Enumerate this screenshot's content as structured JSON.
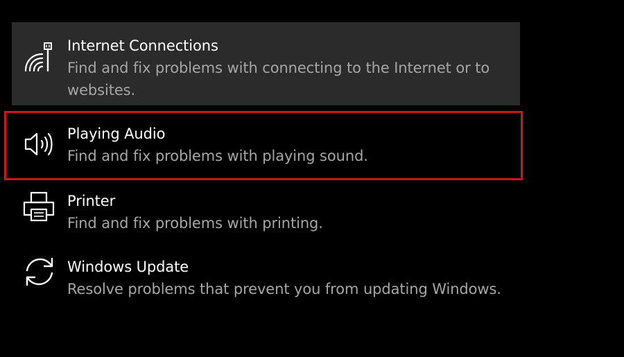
{
  "troubleshooters": [
    {
      "title": "Internet Connections",
      "description": "Find and fix problems with connecting to the Internet or to websites.",
      "icon": "wifi-ethernet-icon"
    },
    {
      "title": "Playing Audio",
      "description": "Find and fix problems with playing sound.",
      "icon": "speaker-icon"
    },
    {
      "title": "Printer",
      "description": "Find and fix problems with printing.",
      "icon": "printer-icon"
    },
    {
      "title": "Windows Update",
      "description": "Resolve problems that prevent you from updating Windows.",
      "icon": "sync-icon"
    }
  ],
  "colors": {
    "background": "#000000",
    "hover_background": "#2b2b2b",
    "title_text": "#ffffff",
    "description_text": "#a6a6a6",
    "highlight_border": "#d4121b"
  }
}
